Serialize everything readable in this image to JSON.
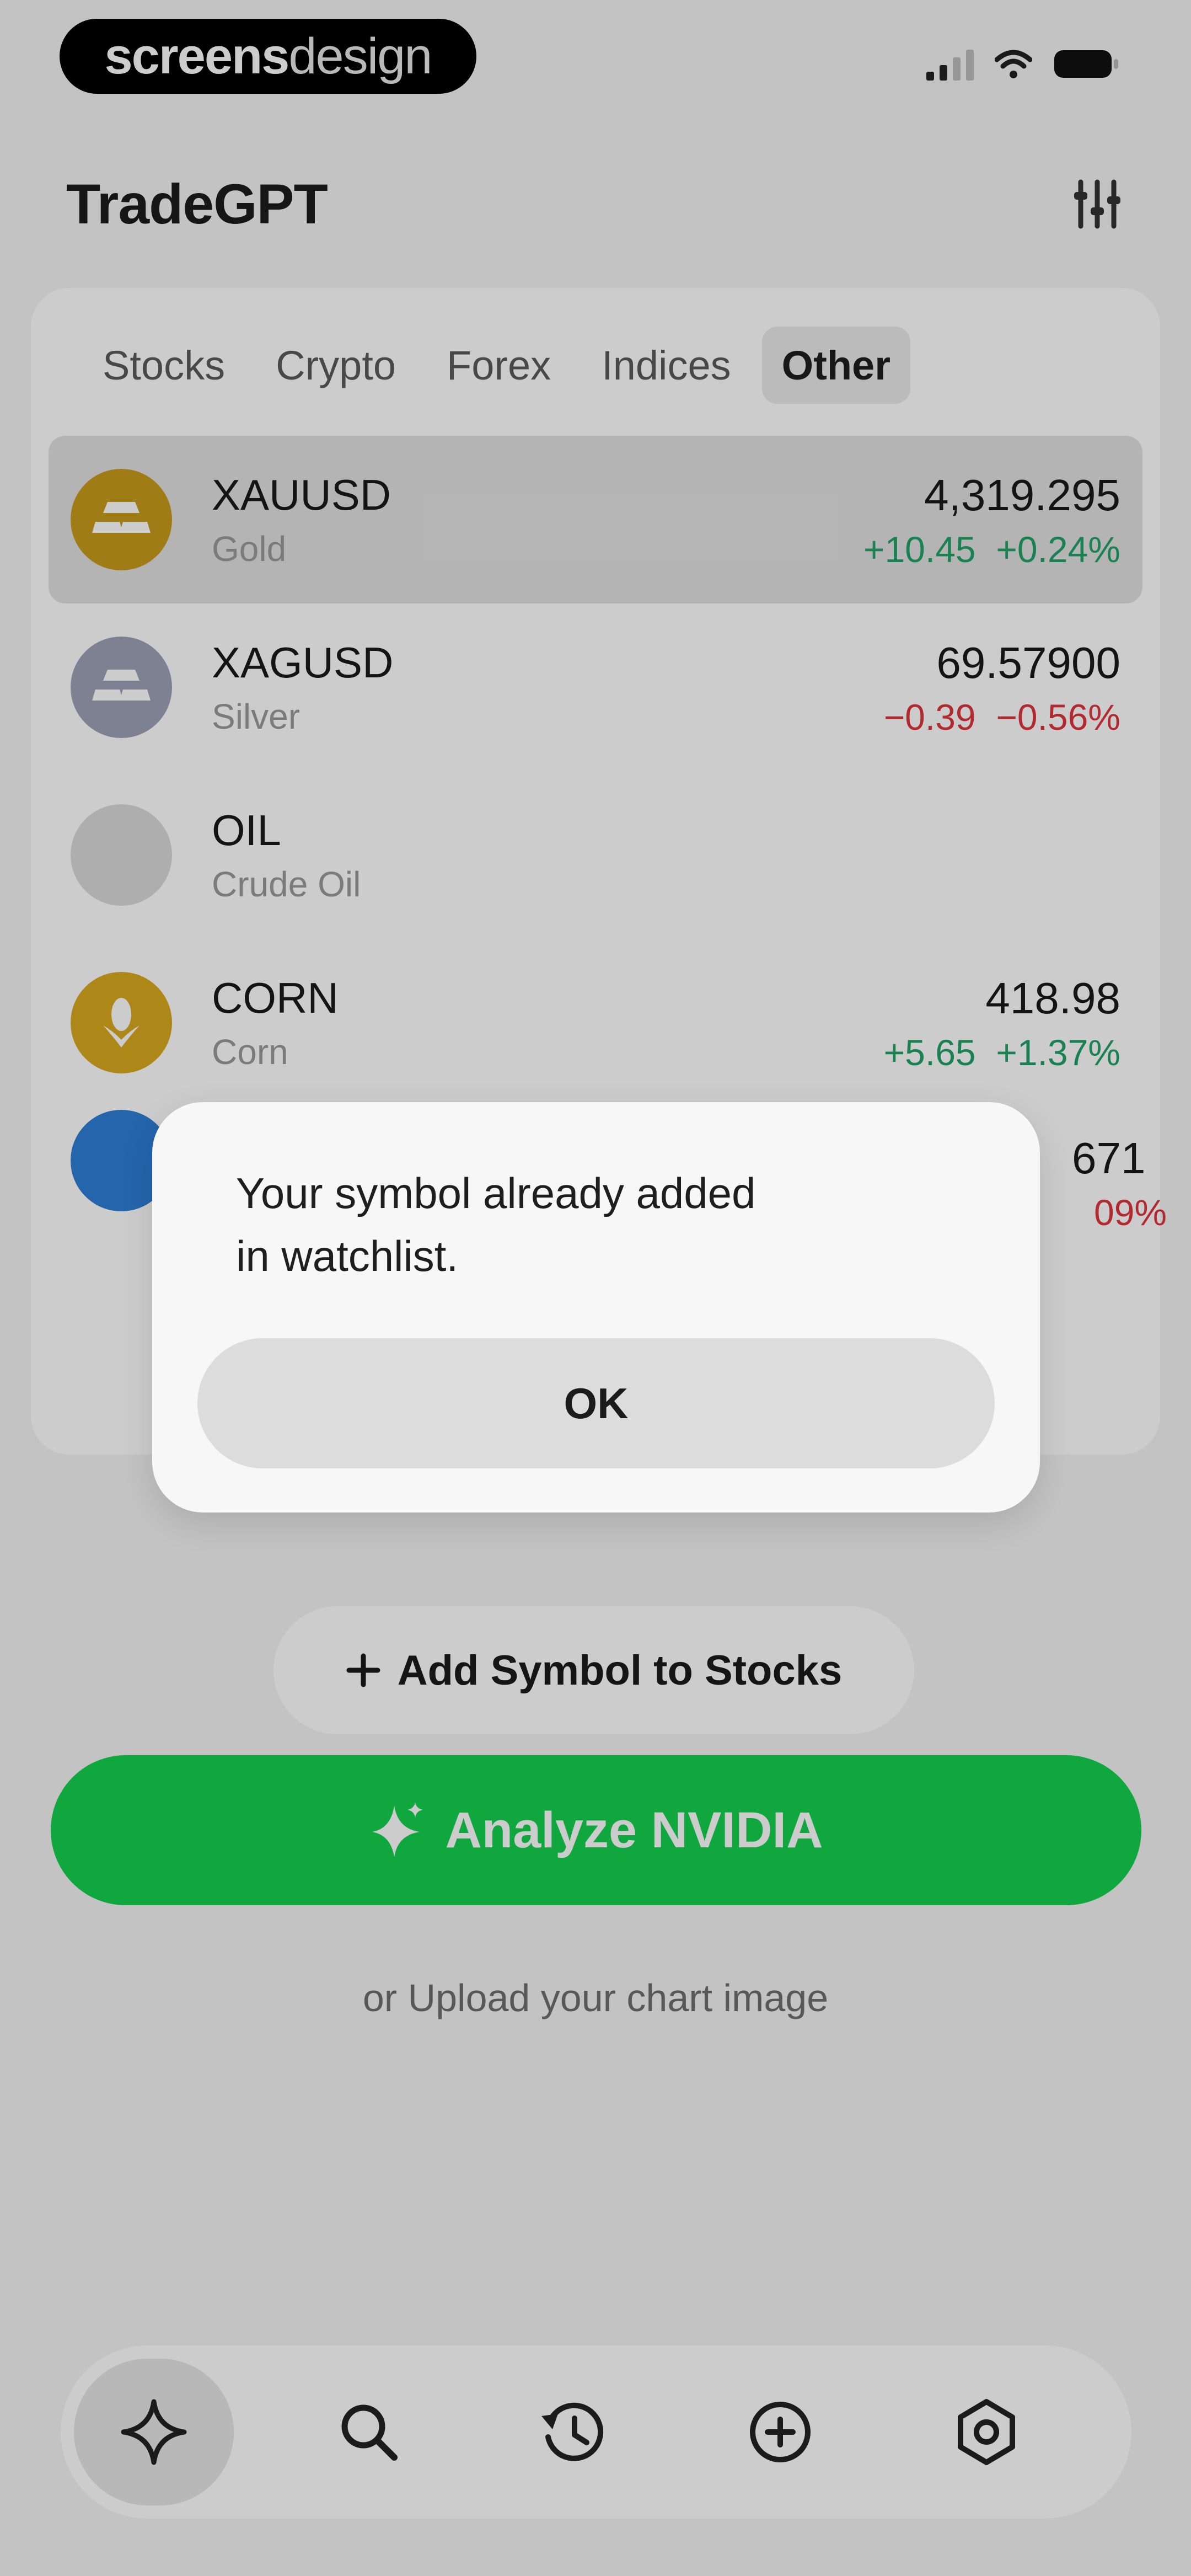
{
  "status_bar": {
    "brand_bold": "screens",
    "brand_light": "design"
  },
  "header": {
    "title": "TradeGPT"
  },
  "tabs": [
    {
      "label": "Stocks"
    },
    {
      "label": "Crypto"
    },
    {
      "label": "Forex"
    },
    {
      "label": "Indices"
    },
    {
      "label": "Other",
      "active": true
    }
  ],
  "rows": [
    {
      "symbol": "XAUUSD",
      "name": "Gold",
      "price": "4,319.295",
      "change": "+10.45",
      "change_pct": "+0.24%",
      "direction": "up",
      "icon": "gold-bars-icon",
      "color": "#c79b1c"
    },
    {
      "symbol": "XAGUSD",
      "name": "Silver",
      "price": "69.57900",
      "change": "−0.39",
      "change_pct": "−0.56%",
      "direction": "down",
      "icon": "silver-bars-icon",
      "color": "#9ea2b7"
    },
    {
      "symbol": "OIL",
      "name": "Crude Oil",
      "price": "",
      "change": "",
      "change_pct": "",
      "direction": "none",
      "icon": "oil-icon",
      "color": "#dadada"
    },
    {
      "symbol": "CORN",
      "name": "Corn",
      "price": "418.98",
      "change": "+5.65",
      "change_pct": "+1.37%",
      "direction": "up",
      "icon": "corn-icon",
      "color": "#d9a91f"
    }
  ],
  "partial_row": {
    "price_fragment": "671",
    "change_fragment": "09%",
    "icon": "water-drop-icon",
    "color": "#2d7fd8"
  },
  "alert": {
    "message_line1": "Your symbol already added",
    "message_line2": "in watchlist.",
    "ok_label": "OK"
  },
  "add_symbol_label": "Add Symbol to Stocks",
  "analyze_label": "Analyze NVIDIA",
  "upload_label": "or Upload your chart image",
  "bottom_nav": [
    {
      "icon": "sparkle-icon",
      "active": true
    },
    {
      "icon": "search-icon"
    },
    {
      "icon": "history-icon"
    },
    {
      "icon": "add-circle-icon"
    },
    {
      "icon": "gear-icon"
    }
  ],
  "colors": {
    "positive": "#21a366",
    "negative": "#e0343d",
    "accent_green": "#14d14f"
  }
}
